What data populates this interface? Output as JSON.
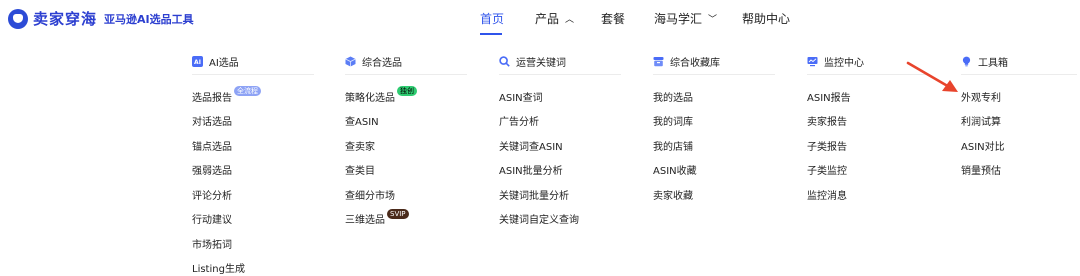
{
  "brand": {
    "name": "卖家穿海",
    "subtitle": "亚马逊AI选品工具"
  },
  "nav": {
    "items": [
      {
        "label": "首页"
      },
      {
        "label": "产品"
      },
      {
        "label": "套餐"
      },
      {
        "label": "海马学汇"
      },
      {
        "label": "帮助中心"
      }
    ]
  },
  "menu": {
    "columns": [
      {
        "title": "AI选品",
        "items": [
          {
            "label": "选品报告",
            "badge": "全流程"
          },
          {
            "label": "对话选品"
          },
          {
            "label": "锚点选品"
          },
          {
            "label": "强弱选品"
          },
          {
            "label": "评论分析"
          },
          {
            "label": "行动建议"
          },
          {
            "label": "市场拓词"
          },
          {
            "label": "Listing生成"
          }
        ]
      },
      {
        "title": "综合选品",
        "items": [
          {
            "label": "策略化选品",
            "badge": "独创"
          },
          {
            "label": "查ASIN"
          },
          {
            "label": "查卖家"
          },
          {
            "label": "查类目"
          },
          {
            "label": "查细分市场"
          },
          {
            "label": "三维选品",
            "badge": "SVIP"
          }
        ]
      },
      {
        "title": "运营关键词",
        "items": [
          {
            "label": "ASIN查词"
          },
          {
            "label": "广告分析"
          },
          {
            "label": "关键词查ASIN"
          },
          {
            "label": "ASIN批量分析"
          },
          {
            "label": "关键词批量分析"
          },
          {
            "label": "关键词自定义查询"
          }
        ]
      },
      {
        "title": "综合收藏库",
        "items": [
          {
            "label": "我的选品"
          },
          {
            "label": "我的词库"
          },
          {
            "label": "我的店铺"
          },
          {
            "label": "ASIN收藏"
          },
          {
            "label": "卖家收藏"
          }
        ]
      },
      {
        "title": "监控中心",
        "items": [
          {
            "label": "ASIN报告"
          },
          {
            "label": "卖家报告"
          },
          {
            "label": "子类报告"
          },
          {
            "label": "子类监控"
          },
          {
            "label": "监控消息"
          }
        ]
      },
      {
        "title": "工具箱",
        "items": [
          {
            "label": "外观专利"
          },
          {
            "label": "利润试算"
          },
          {
            "label": "ASIN对比"
          },
          {
            "label": "销量预估"
          }
        ]
      }
    ]
  },
  "colors": {
    "accent": "#2f54eb",
    "arrow": "#e8442c"
  }
}
